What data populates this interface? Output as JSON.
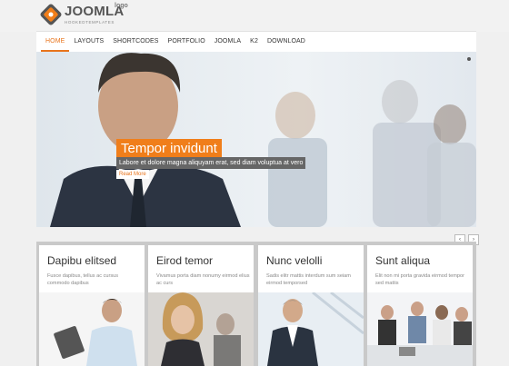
{
  "logo": {
    "word": "JOOMLA",
    "sup": "logo",
    "sub": "HOOKEDTEMPLATES"
  },
  "nav": {
    "items": [
      "HOME",
      "LAYOUTS",
      "SHORTCODES",
      "PORTFOLIO",
      "JOOMLA",
      "K2",
      "DOWNLOAD"
    ],
    "active": 0
  },
  "hero": {
    "title": "Tempor invidunt",
    "text": "Labore et dolore magna aliquyam erat, sed diam voluptua at vero",
    "button": "Read More"
  },
  "slider_controls": {
    "prev": "‹",
    "next": "›"
  },
  "cards": [
    {
      "title": "Dapibu elitsed",
      "desc": "Fusce dapibus, tellus ac cursus commodo dapibus"
    },
    {
      "title": "Eirod temor",
      "desc": "Vivamus porta diam nonumy eirmod elius ac curs"
    },
    {
      "title": "Nunc velolli",
      "desc": "Sadis elitr mattis interdum sum seiam eirmod temporsed"
    },
    {
      "title": "Sunt aliqua",
      "desc": "Elit non mi porta gravida eirmod tempor sed mattis"
    }
  ],
  "colors": {
    "accent": "#e8741c",
    "caption_bg": "#f07e1a"
  }
}
